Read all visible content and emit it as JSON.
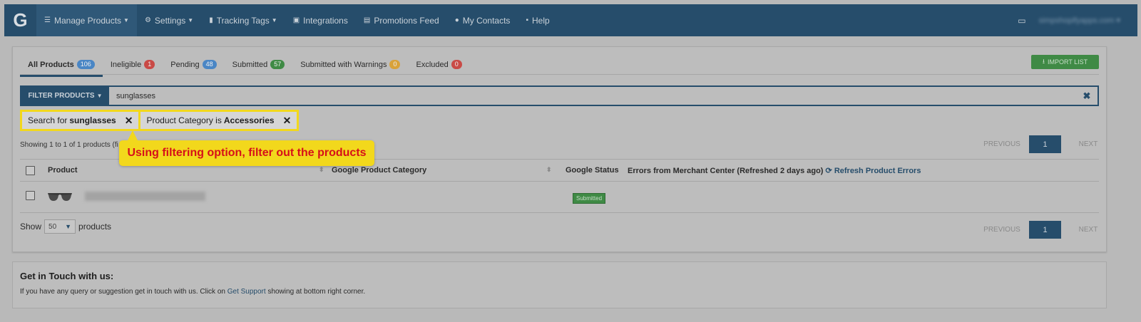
{
  "navbar": {
    "logo": "G",
    "items": [
      {
        "label": "Manage Products",
        "icon": "list-icon",
        "caret": true
      },
      {
        "label": "Settings",
        "icon": "gear-icon",
        "caret": true
      },
      {
        "label": "Tracking Tags",
        "icon": "bar-chart-icon",
        "caret": true
      },
      {
        "label": "Integrations",
        "icon": "briefcase-icon",
        "caret": false
      },
      {
        "label": "Promotions Feed",
        "icon": "clipboard-icon",
        "caret": false
      },
      {
        "label": "My Contacts",
        "icon": "users-icon",
        "caret": false
      },
      {
        "label": "Help",
        "icon": "chat-icon",
        "caret": false
      }
    ],
    "user": "simpshopifyapps.com"
  },
  "tabs": [
    {
      "label": "All Products",
      "count": "106",
      "color": "#4a86c5"
    },
    {
      "label": "Ineligible",
      "count": "1",
      "color": "#c94a46"
    },
    {
      "label": "Pending",
      "count": "48",
      "color": "#4a86c5"
    },
    {
      "label": "Submitted",
      "count": "57",
      "color": "#3f8a45"
    },
    {
      "label": "Submitted with Warnings",
      "count": "0",
      "color": "#d9a23a"
    },
    {
      "label": "Excluded",
      "count": "0",
      "color": "#c94a46"
    }
  ],
  "import_button": "IMPORT LIST",
  "filter": {
    "button": "FILTER PRODUCTS",
    "value": "sunglasses"
  },
  "chips": [
    {
      "prefix": "Search for",
      "value": "sunglasses"
    },
    {
      "prefix": "Product Category is",
      "value": "Accessories"
    }
  ],
  "showing_text": "Showing 1 to 1 of 1 products (fi",
  "callout": "Using filtering option, filter out the products",
  "pager": {
    "previous": "PREVIOUS",
    "page": "1",
    "next": "NEXT"
  },
  "table": {
    "headers": {
      "product": "Product",
      "category": "Google Product Category",
      "status": "Google Status",
      "errors": "Errors from Merchant Center (Refreshed 2 days ago)",
      "refresh": "Refresh Product Errors"
    },
    "rows": [
      {
        "status": "Submitted"
      }
    ]
  },
  "show": {
    "label": "Show",
    "value": "50",
    "suffix": "products"
  },
  "contact": {
    "title": "Get in Touch with us:",
    "text_before": "If you have any query or suggestion get in touch with us. Click on",
    "link": "Get Support",
    "text_after": "showing at bottom right corner."
  }
}
